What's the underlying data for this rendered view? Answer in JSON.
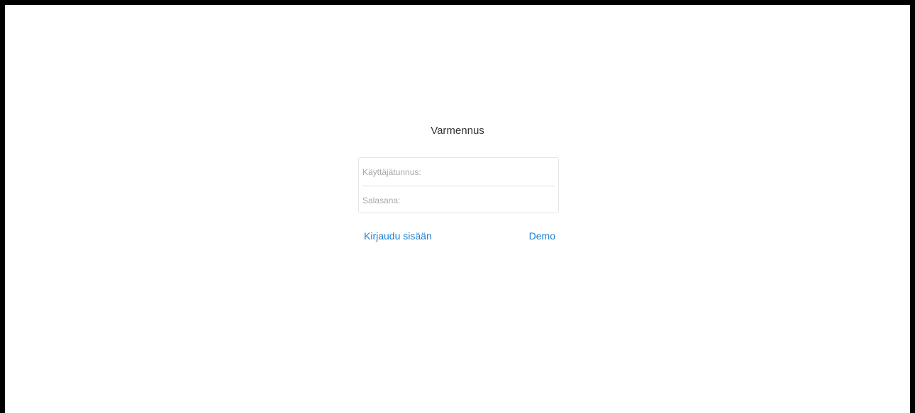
{
  "page": {
    "title": "Varmennus"
  },
  "form": {
    "username_placeholder": "Käyttäjätunnus:",
    "username_value": "",
    "password_placeholder": "Salasana:",
    "password_value": ""
  },
  "actions": {
    "login_label": "Kirjaudu sisään",
    "demo_label": "Demo"
  },
  "colors": {
    "link": "#1a7fd4",
    "border": "#e6e6e6",
    "placeholder": "#a8a8a8",
    "frame": "#000000"
  }
}
